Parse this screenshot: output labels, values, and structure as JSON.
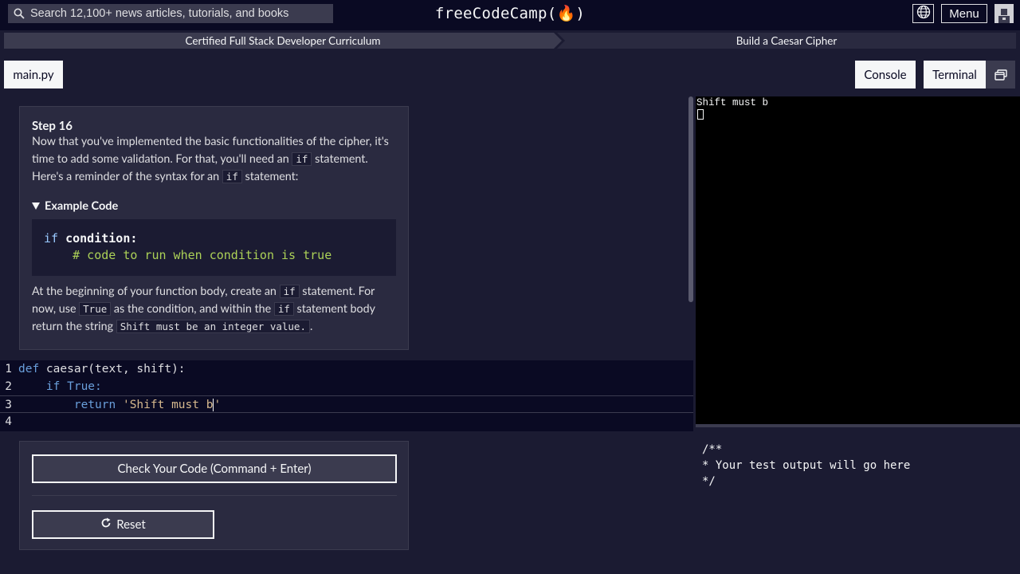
{
  "nav": {
    "search_placeholder": "Search 12,100+ news articles, tutorials, and books",
    "logo": "freeCodeCamp(🔥)",
    "menu_label": "Menu"
  },
  "breadcrumb": {
    "curriculum": "Certified Full Stack Developer Curriculum",
    "project": "Build a Caesar Cipher"
  },
  "tabs": {
    "file": "main.py",
    "console": "Console",
    "terminal": "Terminal"
  },
  "instructions": {
    "step_title": "Step 16",
    "p1_a": "Now that you've implemented the basic functionalities of the cipher, it's time to add some validation. For that, you'll need an ",
    "p1_code1": "if",
    "p1_b": " statement. Here's a reminder of the syntax for an ",
    "p1_code2": "if",
    "p1_c": " statement:",
    "example_label": "Example Code",
    "example_line1_kw": "if",
    "example_line1_rest": " condition:",
    "example_line2": "    # code to run when condition is true",
    "p2_a": "At the beginning of your function body, create an ",
    "p2_code1": "if",
    "p2_b": " statement. For now, use ",
    "p2_code2": "True",
    "p2_c": " as the condition, and within the ",
    "p2_code3": "if",
    "p2_d": " statement body return the string ",
    "p2_code4": "Shift must be an integer value.",
    "p2_e": "."
  },
  "editor": {
    "lines": [
      {
        "num": "1",
        "kw": "def",
        "rest": " caesar(text, shift):"
      },
      {
        "num": "2",
        "indent": "    ",
        "kw": "if",
        "rest": " True:"
      },
      {
        "num": "3",
        "indent": "        ",
        "kw": "return",
        "str": " 'Shift must b",
        "tail": "'"
      },
      {
        "num": "4"
      }
    ]
  },
  "actions": {
    "check_label": "Check Your Code (Command + Enter)",
    "reset_label": "Reset"
  },
  "terminal": {
    "output": "Shift must b"
  },
  "test_output": {
    "text": "/**\n* Your test output will go here\n*/"
  },
  "colors": {
    "background": "#1b1b32",
    "nav": "#0a0a23",
    "panel": "#2a2a40",
    "keyword": "#99c9ff",
    "comment": "#acd157"
  }
}
